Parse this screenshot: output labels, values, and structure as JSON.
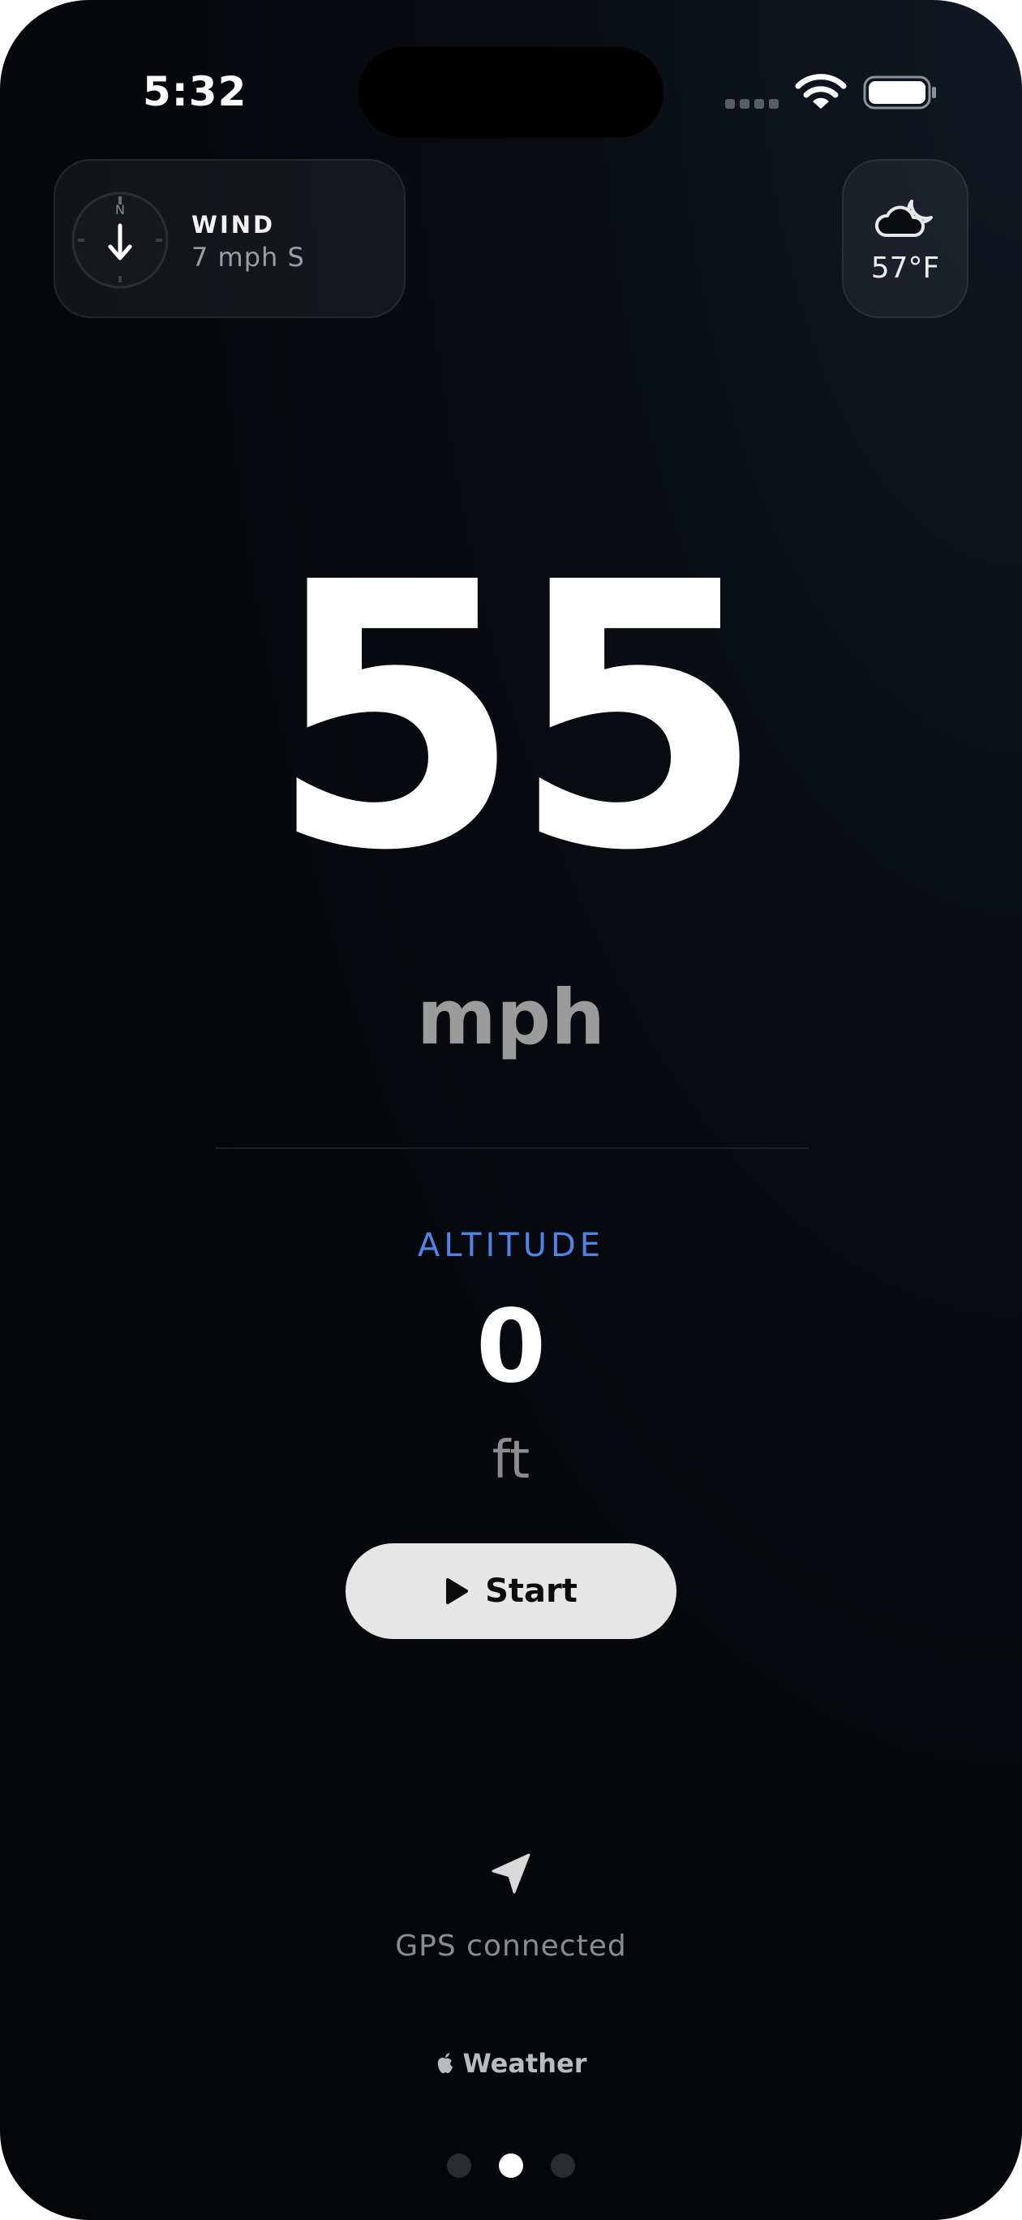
{
  "status_bar": {
    "time": "5:32"
  },
  "wind": {
    "title": "WIND",
    "value": "7 mph S",
    "compass_north": "N",
    "icon": "compass-icon"
  },
  "weather": {
    "temperature": "57°F",
    "icon": "cloud-moon-icon"
  },
  "speedometer": {
    "speed": "55",
    "unit": "mph"
  },
  "altitude": {
    "label": "ALTITUDE",
    "value": "0",
    "unit": "ft"
  },
  "controls": {
    "start_label": "Start",
    "start_icon": "play-icon"
  },
  "gps": {
    "icon": "location-arrow-icon",
    "status": "GPS connected"
  },
  "attribution": {
    "icon": "apple-logo-icon",
    "text": "Weather"
  },
  "pagination": {
    "count": 3,
    "active_index": 1
  },
  "colors": {
    "background": "#05070a",
    "accent_blue": "#4f83e8",
    "button": "#e6e6e6"
  }
}
